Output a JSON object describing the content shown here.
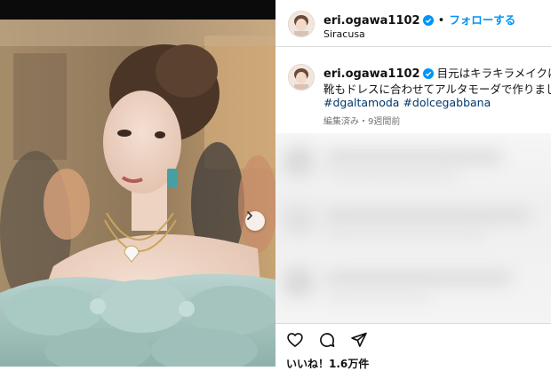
{
  "post_header": {
    "username": "eri.ogawa1102",
    "follow_label": "フォローする",
    "location": "Siracusa"
  },
  "caption": {
    "username": "eri.ogawa1102",
    "line1": "目元はキラキラメイクに💎",
    "line2": "靴もドレスに合わせてアルタモーダで作りまし",
    "hashtag1": "#dgaltamoda",
    "hashtag2": "#dolcegabbana",
    "meta": "編集済み・9週間前"
  },
  "likes_text": "いいね！1.6万件",
  "colors": {
    "accent": "#0095f6",
    "hashtag": "#00376b",
    "verified": "#0095f6"
  },
  "icons": [
    "heart-icon",
    "comment-icon",
    "share-icon",
    "next-arrow-icon",
    "verified-badge-icon"
  ]
}
